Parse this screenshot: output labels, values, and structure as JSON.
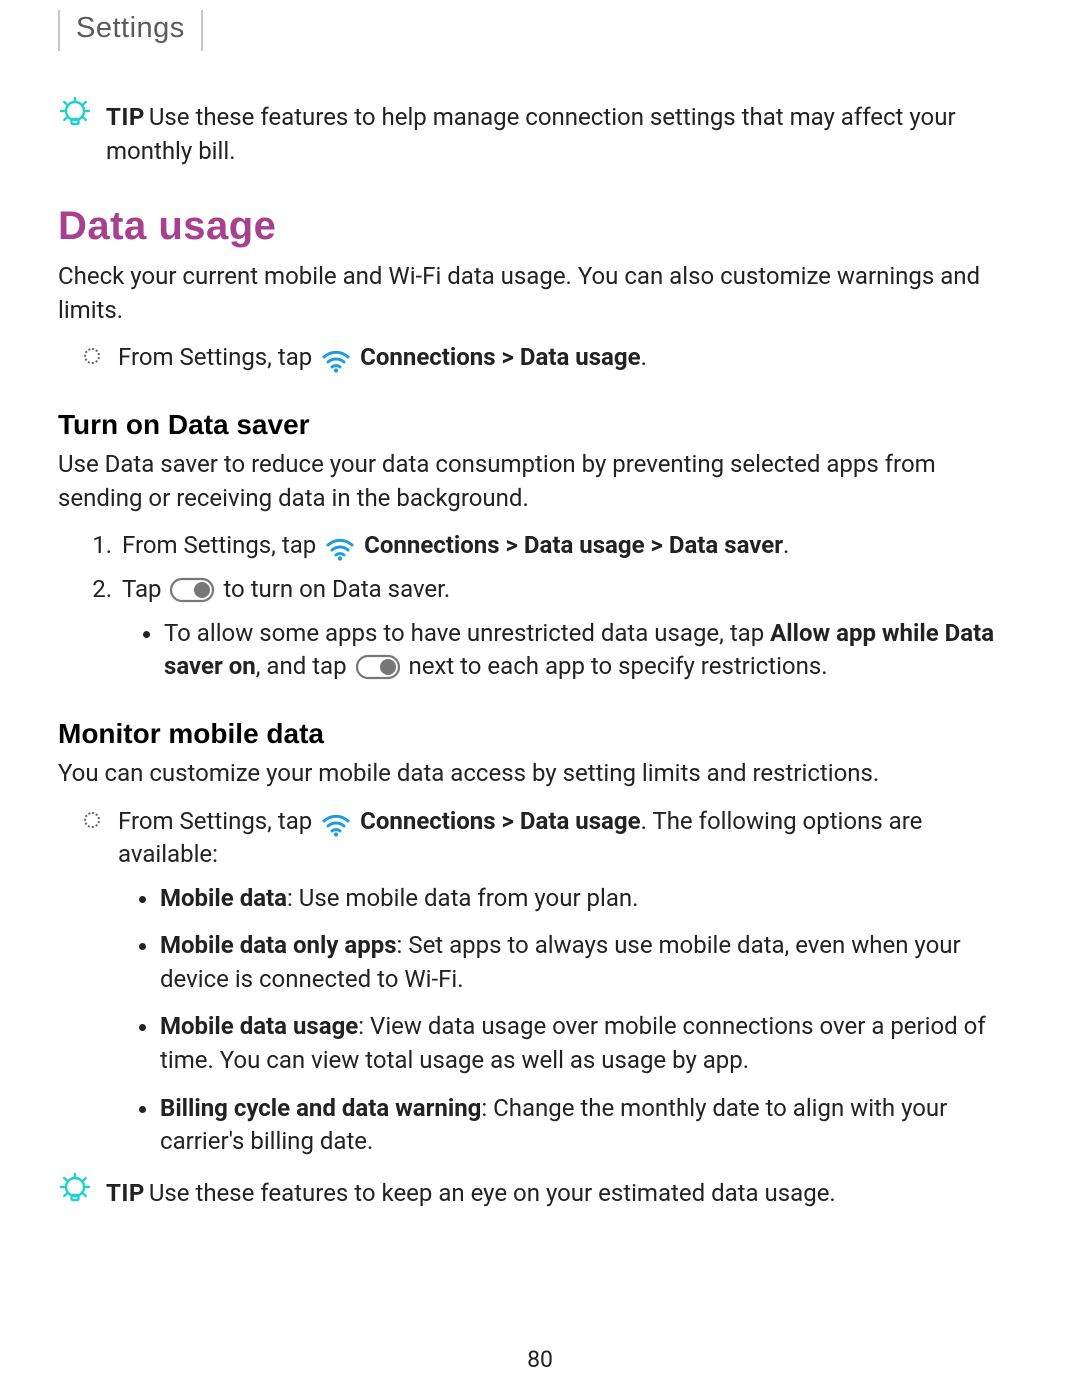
{
  "header": {
    "section_label": "Settings"
  },
  "tip_top": {
    "tip_word": "TIP",
    "text": "Use these features to help manage connection settings that may affect your monthly bill."
  },
  "heading_main": "Data usage",
  "data_usage_intro": "Check your current mobile and Wi-Fi data usage. You can also customize warnings and limits.",
  "data_usage_step": {
    "prefix": "From Settings, tap ",
    "path": "Connections > Data usage",
    "suffix": "."
  },
  "saver": {
    "heading": "Turn on Data saver",
    "intro": "Use Data saver to reduce your data consumption by preventing selected apps from sending or receiving data in the background.",
    "steps": {
      "s1_prefix": "From Settings, tap ",
      "s1_path": "Connections > Data usage > Data saver",
      "s1_suffix": ".",
      "s2_prefix": "Tap ",
      "s2_suffix": " to turn on Data saver.",
      "sub_prefix": "To allow some apps to have unrestricted data usage, tap ",
      "sub_bold1": "Allow app while Data saver on",
      "sub_mid": ", and tap ",
      "sub_suffix": " next to each app to specify restrictions."
    }
  },
  "monitor": {
    "heading": "Monitor mobile data",
    "intro": "You can customize your mobile data access by setting limits and restrictions.",
    "step_prefix": "From Settings, tap ",
    "step_path": "Connections > Data usage",
    "step_suffix": ". The following options are available:",
    "options": {
      "o1_label": "Mobile data",
      "o1_sep": ": ",
      "o1_text": "Use mobile data from your plan.",
      "o2_label": "Mobile data only apps",
      "o2_sep": ": ",
      "o2_text": "Set apps to always use mobile data, even when your device is connected to Wi-Fi.",
      "o3_label": "Mobile data usage",
      "o3_sep": ": ",
      "o3_text": "View data usage over mobile connections over a period of time. You can view total usage as well as usage by app.",
      "o4_label": "Billing cycle and data warning",
      "o4_sep": ": ",
      "o4_text": "Change the monthly date to align with your carrier's billing date."
    }
  },
  "tip_bottom": {
    "tip_word": "TIP",
    "text": "Use these features to keep an eye on your estimated data usage."
  },
  "page_number": "80",
  "colors": {
    "accent": "#a7418f",
    "tip": "#1ed1ce",
    "wifi": "#209ce0"
  }
}
